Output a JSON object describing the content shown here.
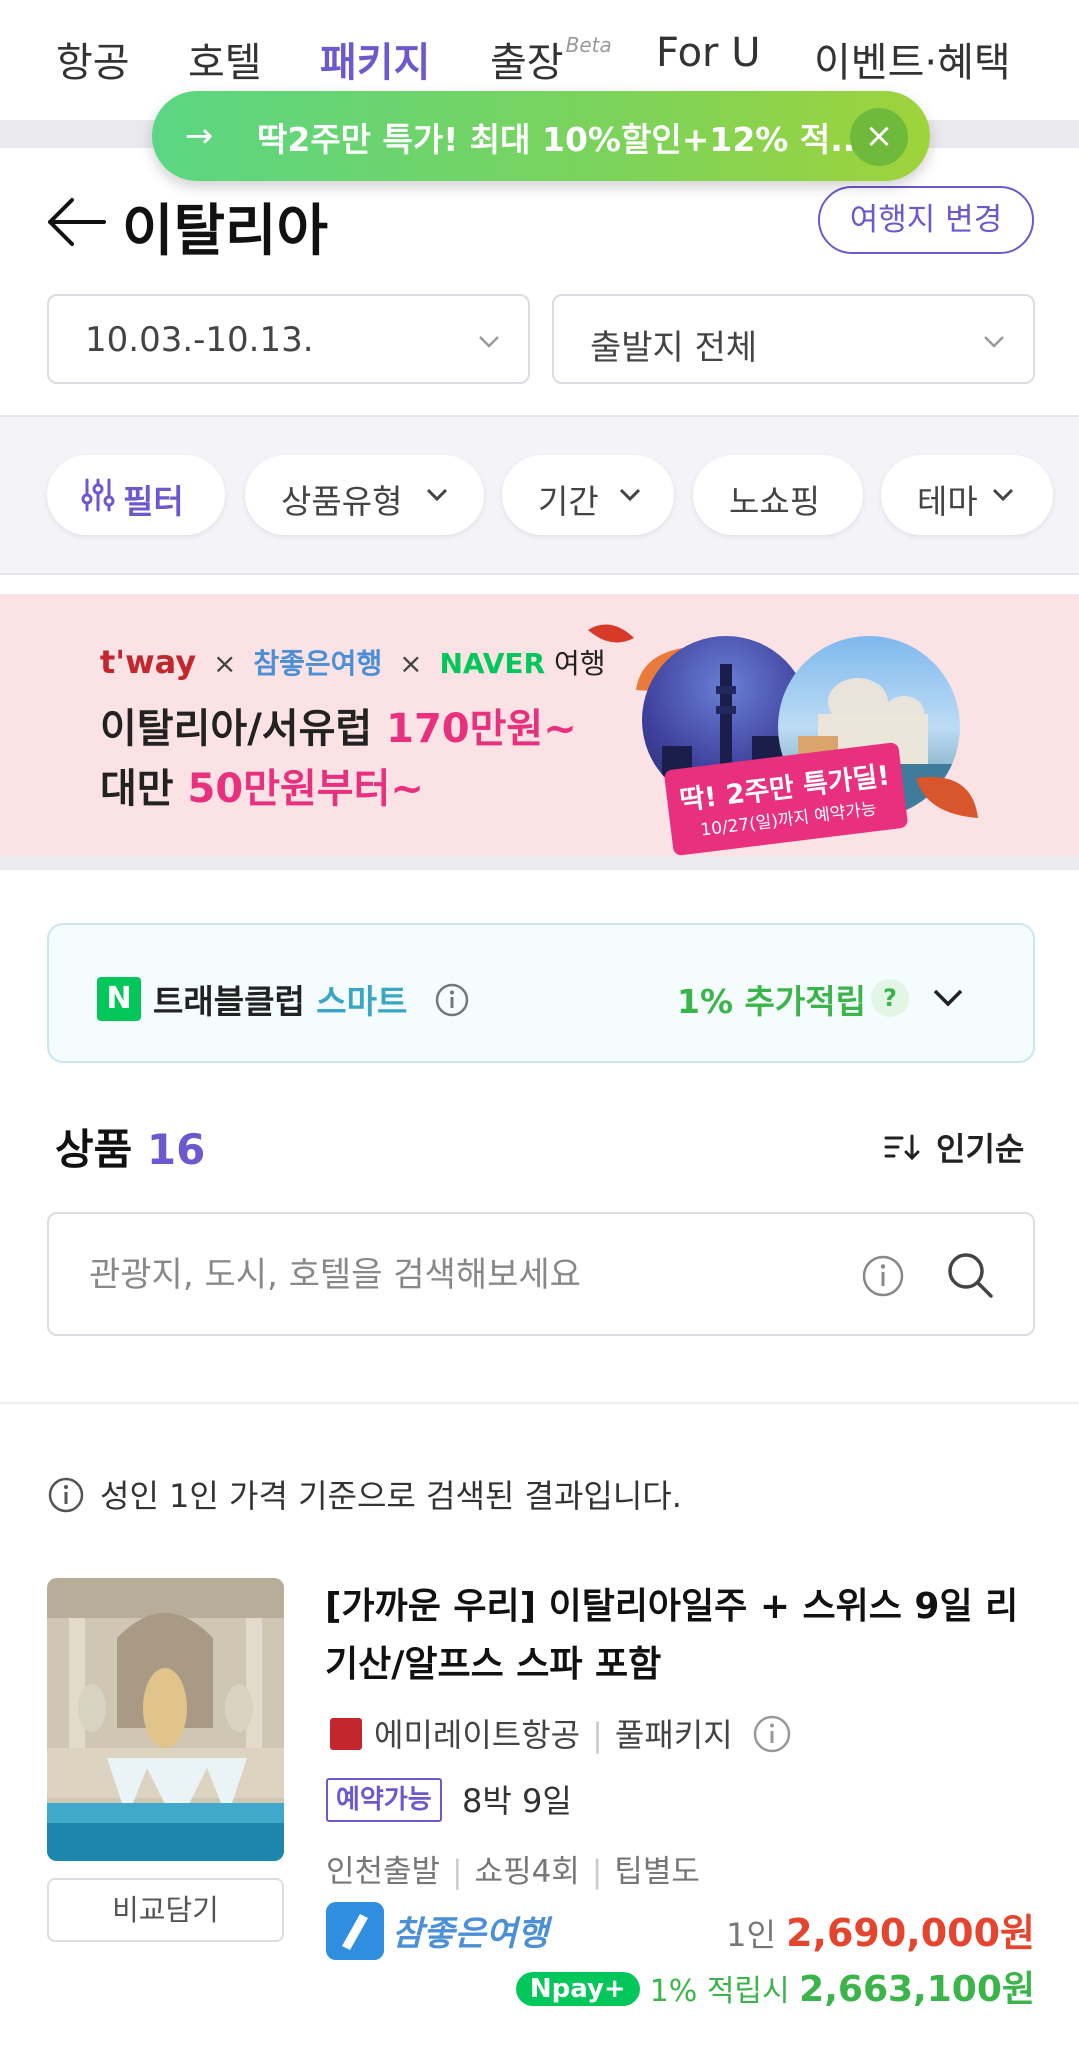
{
  "nav": {
    "tabs": [
      {
        "label": "항공"
      },
      {
        "label": "호텔"
      },
      {
        "label": "패키지"
      },
      {
        "label": "출장"
      },
      {
        "label": "For U"
      },
      {
        "label": "이벤트·혜택"
      }
    ],
    "beta_label": "Beta",
    "active_tab": "패키지"
  },
  "toast": {
    "text": "딱2주만 특가! 최대 10%할인+12% 적...",
    "close_icon": "close-icon",
    "arrow_icon": "arrow-right-icon"
  },
  "header": {
    "title": "이탈리아",
    "change_button": "여행지 변경"
  },
  "selectors": {
    "date": "10.03.-10.13.",
    "departure": "출발지 전체"
  },
  "filters": {
    "filter_label": "필터",
    "chips": [
      "상품유형",
      "기간",
      "노쇼핑",
      "테마"
    ]
  },
  "banner": {
    "brand_tway": "t'way",
    "brand_cham": "참좋은여행",
    "brand_naver": "NAVER",
    "brand_suffix": "여행",
    "times": "×",
    "line1_prefix": "이탈리아/서유럽 ",
    "line1_highlight": "170만원~",
    "line2_prefix": "대만 ",
    "line2_highlight": "50만원부터~",
    "ribbon_title": "딱! 2주만 특가딜!",
    "ribbon_sub": "10/27(일)까지 예약가능"
  },
  "club": {
    "n_logo": "N",
    "name": "트래블클럽 ",
    "smart": "스마트",
    "reward": "1% 추가적립",
    "question": "?"
  },
  "products": {
    "title": "상품",
    "count": "16",
    "sort_label": "인기순"
  },
  "search": {
    "placeholder": "관광지, 도시, 호텔을 검색해보세요"
  },
  "notice": "성인 1인 가격 기준으로 검색된 결과입니다.",
  "product": {
    "title": "[가까운 우리] 이탈리아일주 + 스위스 9일 리기산/알프스 스파 포함",
    "airline": "에미레이트항공",
    "package_type": "풀패키지",
    "badge": "예약가능",
    "duration": "8박 9일",
    "meta": [
      "인천출발",
      "쇼핑4회",
      "팁별도"
    ],
    "seller": "참좋은여행",
    "price_prefix": "1인 ",
    "price": "2,690,000원",
    "npay_label": "Npay+",
    "npay_text": "1% 적립시 ",
    "npay_price": "2,663,100원",
    "compare_button": "비교담기"
  },
  "colors": {
    "accent": "#6a5acd",
    "price": "#e5442f",
    "green": "#3bb54a",
    "banner_bg": "#fbe3e5",
    "pink": "#e8307f"
  }
}
